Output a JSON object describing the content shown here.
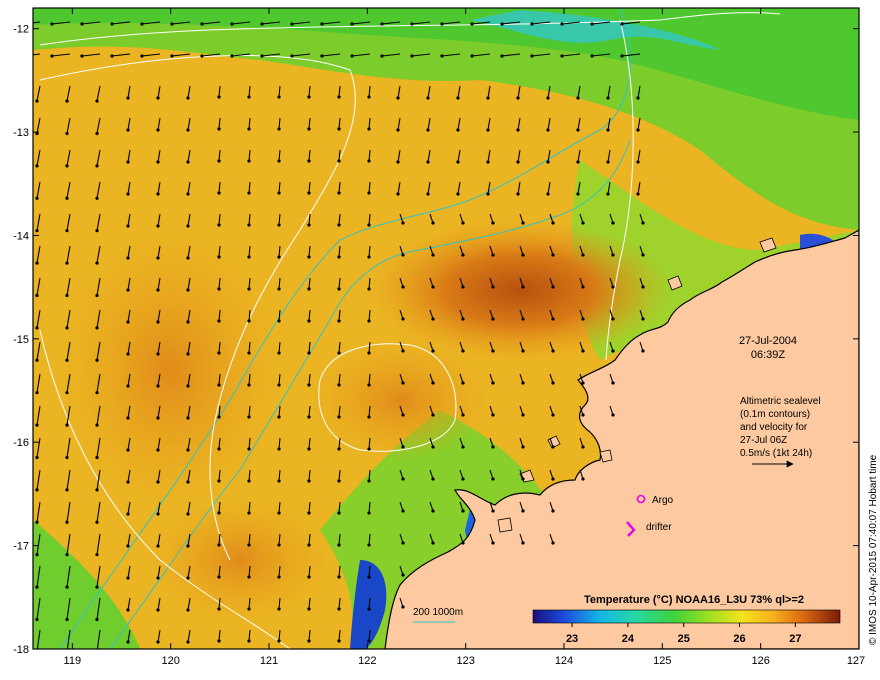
{
  "map": {
    "lon_range": [
      118.6,
      127.0
    ],
    "lat_range": [
      -18.0,
      -11.8
    ],
    "x_ticks": [
      "119",
      "120",
      "121",
      "122",
      "123",
      "124",
      "125",
      "126",
      "127"
    ],
    "y_ticks": [
      "-12",
      "-13",
      "-14",
      "-15",
      "-16",
      "-17",
      "-18"
    ]
  },
  "annotations": {
    "date": "27-Jul-2004",
    "time": "06:39Z",
    "altimetry_lines": [
      "Altimetric sealevel",
      "(0.1m contours)",
      "and velocity for",
      "27-Jul 06Z",
      "0.5m/s (1kt 24h)"
    ]
  },
  "legend": {
    "argo_label": "Argo",
    "drifter_label": "drifter",
    "depth_label": "200  1000m"
  },
  "colorbar": {
    "title": "Temperature (°C) NOAA16_L3U 73% ql>=2",
    "ticks": [
      "23",
      "24",
      "25",
      "26",
      "27"
    ]
  },
  "credit": "© IMOS 10-Apr-2015 07:40:07 Hobart time",
  "colors": {
    "land": "#fcc9a0",
    "bathy": "#2fc4c8",
    "argo": "#e800e8",
    "drifter": "#e800e8"
  }
}
